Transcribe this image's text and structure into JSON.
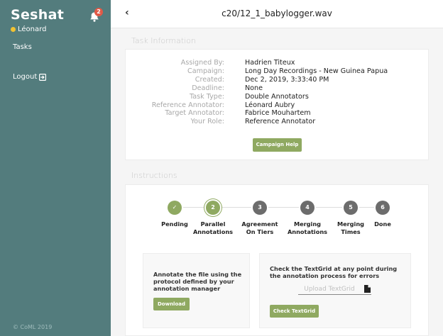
{
  "sidebar": {
    "brand": "Seshat",
    "notification_count": "2",
    "user_name": "Léonard",
    "nav_tasks": "Tasks",
    "nav_logout": "Logout",
    "footer": "© CoML 2019"
  },
  "header": {
    "back_glyph": "‹",
    "title": "c20/12_1_babylogger.wav"
  },
  "task_info": {
    "section_title": "Task Information",
    "rows": [
      {
        "key": "Assigned By:",
        "value": "Hadrien Titeux"
      },
      {
        "key": "Campaign:",
        "value": "Long Day Recordings - New Guinea Papua"
      },
      {
        "key": "Created:",
        "value": "Dec 2, 2019, 3:33:40 PM"
      },
      {
        "key": "Deadline:",
        "value": "None"
      },
      {
        "key": "Task Type:",
        "value": "Double Annotators"
      },
      {
        "key": "Reference Annotator:",
        "value": "Léonard Aubry"
      },
      {
        "key": "Target Annotator:",
        "value": "Fabrice Mouhartem"
      },
      {
        "key": "Your Role:",
        "value": "Reference Annotator"
      }
    ],
    "help_button": "Campaign Help"
  },
  "instructions": {
    "section_title": "Instructions",
    "steps": [
      {
        "num": "✓",
        "line1": "Pending",
        "line2": "",
        "state": "done"
      },
      {
        "num": "2",
        "line1": "Parallel",
        "line2": "Annotations",
        "state": "active"
      },
      {
        "num": "3",
        "line1": "Agreement",
        "line2": "On Tiers",
        "state": "todo"
      },
      {
        "num": "4",
        "line1": "Merging",
        "line2": "Annotations",
        "state": "todo"
      },
      {
        "num": "5",
        "line1": "Merging",
        "line2": "Times",
        "state": "todo"
      },
      {
        "num": "6",
        "line1": "Done",
        "line2": "",
        "state": "todo"
      }
    ],
    "annotate_text": "Annotate the file using the protocol defined by your annotation manager",
    "download_button": "Download",
    "check_text": "Check the TextGrid at any point during the annotation process for errors",
    "upload_placeholder": "Upload TextGrid",
    "check_button": "Check TextGrid"
  },
  "colors": {
    "sidebar": "#537c7d",
    "accent_green": "#8fa961",
    "step_todo": "#6c6c6c",
    "badge": "#e05a47",
    "user_status": "#f1c232"
  }
}
